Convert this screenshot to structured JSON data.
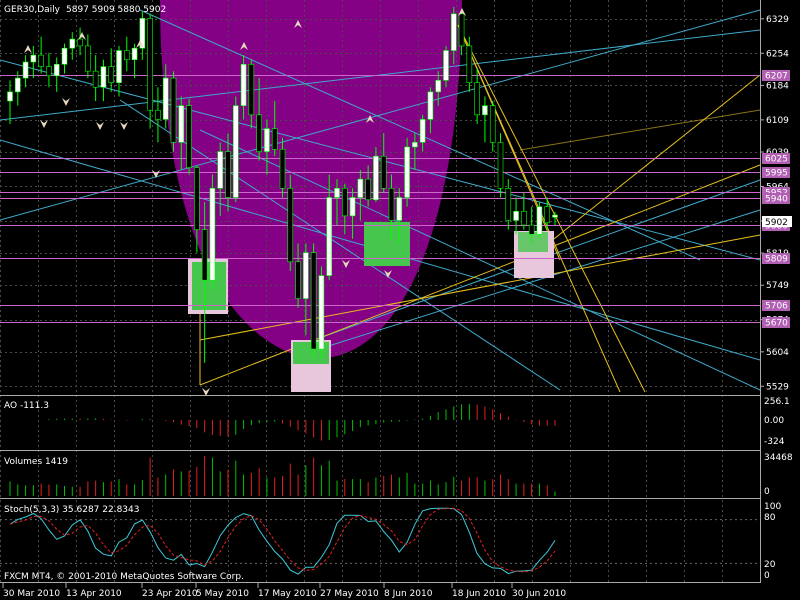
{
  "chart_data": {
    "type": "candlestick",
    "symbol_label": "GER30,Daily",
    "ohlc_label": "5897 5909 5880 5902",
    "current_price": "5902",
    "price_ticks": [
      "6329",
      "6254",
      "6184",
      "6109",
      "6039",
      "5964",
      "5889",
      "5819",
      "5749",
      "5674",
      "5604",
      "5529"
    ],
    "level_labels": [
      "6207",
      "6025",
      "5995",
      "5952",
      "5940",
      "5880",
      "5809",
      "5706",
      "5670"
    ],
    "x_ticks": [
      "30 Mar 2010",
      "13 Apr 2010",
      "23 Apr 2010",
      "5 May 2010",
      "17 May 2010",
      "27 May 2010",
      "8 Jun 2010",
      "18 Jun 2010",
      "30 Jun 2010"
    ],
    "price_range": [
      5510,
      6370
    ],
    "candles": [
      {
        "o": 6150,
        "h": 6195,
        "l": 6100,
        "c": 6170
      },
      {
        "o": 6170,
        "h": 6215,
        "l": 6140,
        "c": 6200
      },
      {
        "o": 6200,
        "h": 6250,
        "l": 6180,
        "c": 6235
      },
      {
        "o": 6235,
        "h": 6270,
        "l": 6200,
        "c": 6250
      },
      {
        "o": 6250,
        "h": 6290,
        "l": 6210,
        "c": 6225
      },
      {
        "o": 6225,
        "h": 6255,
        "l": 6180,
        "c": 6205
      },
      {
        "o": 6205,
        "h": 6245,
        "l": 6170,
        "c": 6230
      },
      {
        "o": 6230,
        "h": 6275,
        "l": 6210,
        "c": 6265
      },
      {
        "o": 6265,
        "h": 6300,
        "l": 6240,
        "c": 6285
      },
      {
        "o": 6285,
        "h": 6310,
        "l": 6250,
        "c": 6270
      },
      {
        "o": 6270,
        "h": 6295,
        "l": 6200,
        "c": 6215
      },
      {
        "o": 6215,
        "h": 6250,
        "l": 6150,
        "c": 6180
      },
      {
        "o": 6180,
        "h": 6240,
        "l": 6150,
        "c": 6225
      },
      {
        "o": 6225,
        "h": 6265,
        "l": 6170,
        "c": 6190
      },
      {
        "o": 6190,
        "h": 6270,
        "l": 6160,
        "c": 6260
      },
      {
        "o": 6260,
        "h": 6290,
        "l": 6215,
        "c": 6240
      },
      {
        "o": 6240,
        "h": 6275,
        "l": 6200,
        "c": 6265
      },
      {
        "o": 6265,
        "h": 6345,
        "l": 6240,
        "c": 6330
      },
      {
        "o": 6330,
        "h": 6340,
        "l": 6090,
        "c": 6130
      },
      {
        "o": 6130,
        "h": 6180,
        "l": 6060,
        "c": 6110
      },
      {
        "o": 6110,
        "h": 6230,
        "l": 6090,
        "c": 6200
      },
      {
        "o": 6200,
        "h": 6215,
        "l": 6040,
        "c": 6060
      },
      {
        "o": 6060,
        "h": 6160,
        "l": 6000,
        "c": 6140
      },
      {
        "o": 6140,
        "h": 6155,
        "l": 5990,
        "c": 6005
      },
      {
        "o": 6005,
        "h": 6010,
        "l": 5820,
        "c": 5870
      },
      {
        "o": 5870,
        "h": 5930,
        "l": 5580,
        "c": 5760
      },
      {
        "o": 5760,
        "h": 5990,
        "l": 5740,
        "c": 5960
      },
      {
        "o": 5960,
        "h": 6060,
        "l": 5900,
        "c": 6040
      },
      {
        "o": 6040,
        "h": 6080,
        "l": 5910,
        "c": 5940
      },
      {
        "o": 5940,
        "h": 6160,
        "l": 5930,
        "c": 6140
      },
      {
        "o": 6140,
        "h": 6250,
        "l": 6110,
        "c": 6230
      },
      {
        "o": 6230,
        "h": 6240,
        "l": 6090,
        "c": 6120
      },
      {
        "o": 6120,
        "h": 6200,
        "l": 6020,
        "c": 6040
      },
      {
        "o": 6040,
        "h": 6110,
        "l": 5990,
        "c": 6090
      },
      {
        "o": 6090,
        "h": 6150,
        "l": 6030,
        "c": 6045
      },
      {
        "o": 6045,
        "h": 6070,
        "l": 5940,
        "c": 5960
      },
      {
        "o": 5960,
        "h": 5990,
        "l": 5780,
        "c": 5800
      },
      {
        "o": 5800,
        "h": 5840,
        "l": 5700,
        "c": 5720
      },
      {
        "o": 5720,
        "h": 5840,
        "l": 5640,
        "c": 5820
      },
      {
        "o": 5820,
        "h": 5840,
        "l": 5590,
        "c": 5610
      },
      {
        "o": 5610,
        "h": 5790,
        "l": 5590,
        "c": 5770
      },
      {
        "o": 5770,
        "h": 5990,
        "l": 5760,
        "c": 5940
      },
      {
        "o": 5940,
        "h": 5980,
        "l": 5880,
        "c": 5960
      },
      {
        "o": 5960,
        "h": 5970,
        "l": 5860,
        "c": 5900
      },
      {
        "o": 5900,
        "h": 5960,
        "l": 5850,
        "c": 5940
      },
      {
        "o": 5940,
        "h": 6000,
        "l": 5890,
        "c": 5980
      },
      {
        "o": 5980,
        "h": 6010,
        "l": 5920,
        "c": 5935
      },
      {
        "o": 5935,
        "h": 6050,
        "l": 5930,
        "c": 6030
      },
      {
        "o": 6030,
        "h": 6080,
        "l": 5950,
        "c": 5960
      },
      {
        "o": 5960,
        "h": 5990,
        "l": 5850,
        "c": 5890
      },
      {
        "o": 5890,
        "h": 5960,
        "l": 5840,
        "c": 5940
      },
      {
        "o": 5940,
        "h": 6070,
        "l": 5920,
        "c": 6050
      },
      {
        "o": 6050,
        "h": 6080,
        "l": 6000,
        "c": 6060
      },
      {
        "o": 6060,
        "h": 6120,
        "l": 6040,
        "c": 6110
      },
      {
        "o": 6110,
        "h": 6180,
        "l": 6080,
        "c": 6170
      },
      {
        "o": 6170,
        "h": 6215,
        "l": 6140,
        "c": 6195
      },
      {
        "o": 6195,
        "h": 6270,
        "l": 6180,
        "c": 6260
      },
      {
        "o": 6260,
        "h": 6355,
        "l": 6230,
        "c": 6340
      },
      {
        "o": 6340,
        "h": 6350,
        "l": 6250,
        "c": 6270
      },
      {
        "o": 6270,
        "h": 6290,
        "l": 6170,
        "c": 6190
      },
      {
        "o": 6190,
        "h": 6220,
        "l": 6100,
        "c": 6120
      },
      {
        "o": 6120,
        "h": 6160,
        "l": 6060,
        "c": 6140
      },
      {
        "o": 6140,
        "h": 6150,
        "l": 6040,
        "c": 6060
      },
      {
        "o": 6060,
        "h": 6080,
        "l": 5940,
        "c": 5960
      },
      {
        "o": 5960,
        "h": 5980,
        "l": 5870,
        "c": 5890
      },
      {
        "o": 5890,
        "h": 5940,
        "l": 5860,
        "c": 5910
      },
      {
        "o": 5910,
        "h": 5950,
        "l": 5870,
        "c": 5880
      },
      {
        "o": 5880,
        "h": 5920,
        "l": 5840,
        "c": 5860
      },
      {
        "o": 5860,
        "h": 5930,
        "l": 5850,
        "c": 5920
      },
      {
        "o": 5920,
        "h": 5940,
        "l": 5870,
        "c": 5885
      },
      {
        "o": 5897,
        "h": 5909,
        "l": 5880,
        "c": 5902
      }
    ],
    "indicators": {
      "ao": {
        "label": "AO -111.3",
        "ticks": [
          "256.1",
          "0.00",
          "-324"
        ]
      },
      "volumes": {
        "label": "Volumes 1419",
        "ticks": [
          "34468",
          "0"
        ]
      },
      "stoch": {
        "label": "Stoch(5,3,3) 35.6287 22.8343",
        "ticks": [
          "100",
          "80",
          "20",
          "0"
        ]
      }
    },
    "footer": "FXCM MT4, © 2001-2010 MetaQuotes Software Corp."
  },
  "colors": {
    "bull": "#ffffff",
    "bear": "#000000",
    "candle_outline": "#00ff00",
    "purple_area": "#8b008b",
    "grid": "#4a4a4a",
    "level_line": "#cc66cc",
    "cyan": "#3fa9c9",
    "yellow": "#e6c020"
  }
}
